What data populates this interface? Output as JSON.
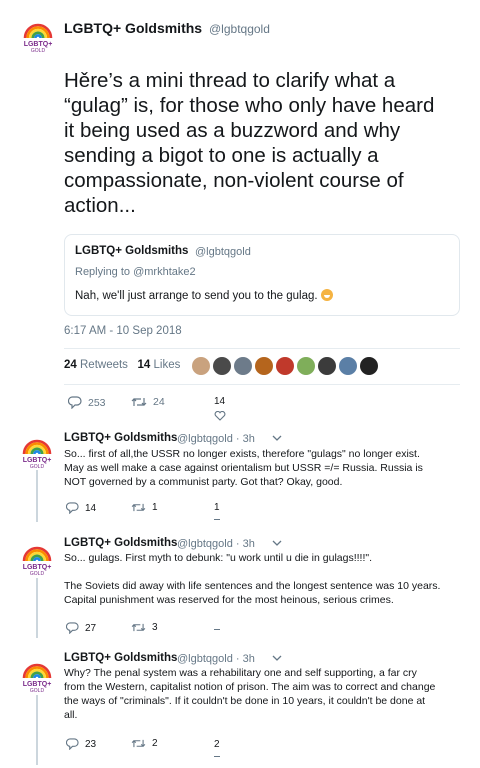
{
  "main_tweet": {
    "name": "LGBTQ+ Goldsmiths",
    "handle": "@lgbtqgold",
    "logo_text": "LGBTQ+",
    "logo_sub": "GOLD",
    "lines": [
      "Hěre’s a mini thread to clarify what a",
      "“gulag” is, for those who only have heard",
      "it being used as a buzzword and why",
      "sending a bigot to one is actually a",
      "compassionate, non-violent course of",
      "action..."
    ],
    "quote": {
      "name": "LGBTQ+ Goldsmiths",
      "handle": "@lgbtqgold",
      "replying_to": "Replying to @mrkhtake2",
      "text": "Nah, we'll just arrange to send you to the gulag."
    },
    "timestamp": "6:17 AM - 10 Sep 2018",
    "retweet_count": "24",
    "retweets_label": "Retweets",
    "like_count": "14",
    "likes_label": "Likes",
    "liker_colors": [
      "#c9a27e",
      "#4a4a4a",
      "#6d7b8a",
      "#b5651d",
      "#c0392b",
      "#7fae5a",
      "#3b3b3b",
      "#5b7fa6",
      "#222222"
    ],
    "actions": {
      "replies": "253",
      "retweets": "24",
      "likes": "14"
    }
  },
  "replies": [
    {
      "name": "LGBTQ+ Goldsmiths",
      "handle": "@lgbtqgold",
      "time": "3h",
      "lines": [
        "So... first of all,the USSR no longer exists, therefore \"gulags\" no longer exist.",
        "May as well make a case against orientalism but USSR =/= Russia. Russia is",
        "NOT governed by a communist party. Got that? Okay, good."
      ],
      "replies": "14",
      "retweets": "1",
      "likes": "1"
    },
    {
      "name": "LGBTQ+ Goldsmiths",
      "handle": "@lgbtqgold",
      "time": "3h",
      "lines": [
        "So... gulags. First myth to debunk: \"u work until u die in gulags!!!!\".",
        "",
        "The Soviets did away with life sentences and the longest sentence was 10 years.",
        "Capital punishment was reserved for the most heinous, serious crimes."
      ],
      "replies": "27",
      "retweets": "3",
      "likes": ""
    },
    {
      "name": "LGBTQ+ Goldsmiths",
      "handle": "@lgbtqgold",
      "time": "3h",
      "lines": [
        "Why? The penal system was a rehabilitary one and self supporting, a far cry",
        "from the Western, capitalist notion of prison. The aim was to correct and change",
        "the ways of \"criminals\". If it couldn't be done in 10 years, it couldn't be done at",
        "all."
      ],
      "replies": "23",
      "retweets": "2",
      "likes": "2"
    }
  ]
}
